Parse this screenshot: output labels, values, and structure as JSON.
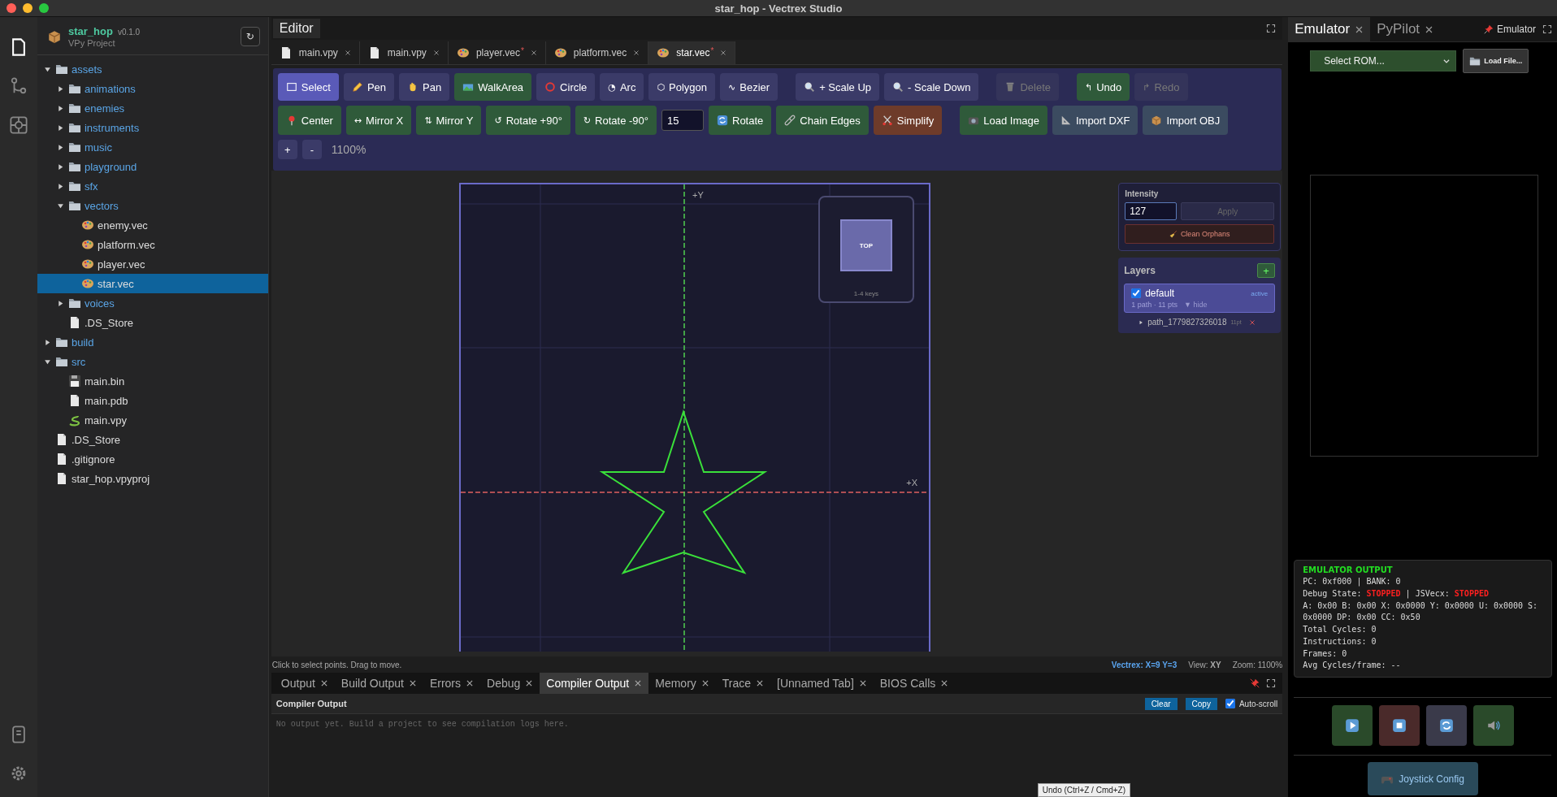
{
  "window": {
    "title": "star_hop - Vectrex Studio"
  },
  "sidebar": {
    "project": {
      "name": "star_hop",
      "version": "v0.1.0",
      "type": "VPy Project",
      "refresh": "↻"
    },
    "tree": [
      {
        "label": "assets",
        "kind": "folder",
        "expanded": true,
        "selected": false,
        "children": [
          {
            "label": "animations",
            "kind": "folder",
            "expanded": false,
            "selected": false
          },
          {
            "label": "enemies",
            "kind": "folder",
            "expanded": false,
            "selected": false
          },
          {
            "label": "instruments",
            "kind": "folder",
            "expanded": false,
            "selected": false
          },
          {
            "label": "music",
            "kind": "folder",
            "expanded": false,
            "selected": false
          },
          {
            "label": "playground",
            "kind": "folder",
            "expanded": false,
            "selected": false
          },
          {
            "label": "sfx",
            "kind": "folder",
            "expanded": false,
            "selected": false
          },
          {
            "label": "vectors",
            "kind": "folder",
            "expanded": true,
            "selected": false,
            "children": [
              {
                "label": "enemy.vec",
                "kind": "vector",
                "selected": false
              },
              {
                "label": "platform.vec",
                "kind": "vector",
                "selected": false
              },
              {
                "label": "player.vec",
                "kind": "vector",
                "selected": false
              },
              {
                "label": "star.vec",
                "kind": "vector",
                "selected": true
              }
            ]
          },
          {
            "label": "voices",
            "kind": "folder",
            "expanded": false,
            "selected": false
          },
          {
            "label": ".DS_Store",
            "kind": "file",
            "selected": false
          }
        ]
      },
      {
        "label": "build",
        "kind": "folder",
        "expanded": false,
        "selected": false
      },
      {
        "label": "src",
        "kind": "folder",
        "expanded": true,
        "selected": false,
        "children": [
          {
            "label": "main.bin",
            "kind": "binary",
            "selected": false
          },
          {
            "label": "main.pdb",
            "kind": "file",
            "selected": false
          },
          {
            "label": "main.vpy",
            "kind": "script",
            "selected": false
          }
        ]
      },
      {
        "label": ".DS_Store",
        "kind": "file",
        "selected": false
      },
      {
        "label": ".gitignore",
        "kind": "file",
        "selected": false
      },
      {
        "label": "star_hop.vpyproj",
        "kind": "file",
        "selected": false
      }
    ]
  },
  "editor": {
    "title": "Editor",
    "tabs": [
      {
        "label": "main.vpy",
        "kind": "file",
        "selected": false
      },
      {
        "label": "main.vpy",
        "kind": "file",
        "selected": false
      },
      {
        "label": "player.vec",
        "kind": "vector",
        "dirty_mark": "*",
        "selected": false
      },
      {
        "label": "platform.vec",
        "kind": "vector",
        "selected": false
      },
      {
        "label": "star.vec",
        "kind": "vector",
        "dirty_mark": "*",
        "selected": true
      }
    ],
    "toolbar": {
      "rows": [
        {
          "groups": [
            {
              "items": [
                {
                  "kind": "button",
                  "label": "Select",
                  "color": "#5a5ab8",
                  "disabled": false
                },
                {
                  "kind": "button",
                  "label": "Pen",
                  "color": "#3b3b68",
                  "disabled": false
                },
                {
                  "kind": "button",
                  "label": "Pan",
                  "color": "#3b3b68",
                  "disabled": false
                },
                {
                  "kind": "button",
                  "label": "WalkArea",
                  "color": "#2f5a3a",
                  "disabled": false
                },
                {
                  "kind": "button",
                  "label": "Circle",
                  "color": "#3b3b68",
                  "disabled": false
                },
                {
                  "kind": "button",
                  "glyph": "◔",
                  "label": "Arc",
                  "color": "#3b3b68",
                  "disabled": false
                },
                {
                  "kind": "button",
                  "glyph": "⬡",
                  "label": "Polygon",
                  "color": "#3b3b68",
                  "disabled": false
                },
                {
                  "kind": "button",
                  "glyph": "∿",
                  "label": "Bezier",
                  "color": "#3b3b68",
                  "disabled": false
                }
              ]
            },
            {
              "items": [
                {
                  "kind": "button",
                  "label": "+ Scale Up",
                  "color": "#3b3b68",
                  "disabled": false
                },
                {
                  "kind": "button",
                  "label": "- Scale Down",
                  "color": "#3b3b68",
                  "disabled": false
                }
              ]
            },
            {
              "items": [
                {
                  "kind": "button",
                  "label": "Delete",
                  "color": "#34345a",
                  "disabled": true
                }
              ]
            },
            {
              "items": [
                {
                  "kind": "button",
                  "glyph": "↰",
                  "label": "Undo",
                  "color": "#2f5a3a",
                  "disabled": false
                },
                {
                  "kind": "button",
                  "glyph": "↱",
                  "label": "Redo",
                  "color": "#34345a",
                  "disabled": true
                }
              ]
            }
          ]
        },
        {
          "groups": [
            {
              "items": [
                {
                  "kind": "button",
                  "label": "Center",
                  "color": "#2f5a3a",
                  "disabled": false
                },
                {
                  "kind": "button",
                  "glyph": "↔",
                  "label": "Mirror X",
                  "color": "#2f5a3a",
                  "disabled": false
                },
                {
                  "kind": "button",
                  "glyph": "⇅",
                  "label": "Mirror Y",
                  "color": "#2f5a3a",
                  "disabled": false
                },
                {
                  "kind": "button",
                  "glyph": "↺",
                  "label": "Rotate +90°",
                  "color": "#2f5a3a",
                  "disabled": false
                },
                {
                  "kind": "button",
                  "glyph": "↻",
                  "label": "Rotate -90°",
                  "color": "#2f5a3a",
                  "disabled": false
                },
                {
                  "kind": "input",
                  "value": "15"
                },
                {
                  "kind": "button",
                  "label": "Rotate",
                  "color": "#2f5a3a",
                  "disabled": false
                },
                {
                  "kind": "button",
                  "label": "Chain Edges",
                  "color": "#2f5a3a",
                  "disabled": false
                },
                {
                  "kind": "button",
                  "label": "Simplify",
                  "color": "#6e3b2a",
                  "disabled": false
                }
              ]
            },
            {
              "items": [
                {
                  "kind": "button",
                  "label": "Load Image",
                  "color": "#2f5a3a",
                  "disabled": false
                },
                {
                  "kind": "button",
                  "label": "Import DXF",
                  "color": "#3b4b60",
                  "disabled": false
                },
                {
                  "kind": "button",
                  "label": "Import OBJ",
                  "color": "#3b4b60",
                  "disabled": false
                }
              ]
            }
          ]
        },
        {
          "groups": [
            {
              "items": [
                {
                  "kind": "small",
                  "label": "+",
                  "color": "#3b3b68",
                  "disabled": false
                },
                {
                  "kind": "small",
                  "label": "-",
                  "color": "#3b3b68",
                  "disabled": false
                },
                {
                  "kind": "text",
                  "label": "1100%"
                }
              ]
            }
          ]
        }
      ]
    },
    "canvas": {
      "y_axis": "+Y",
      "x_axis": "+X",
      "view_cube": {
        "face": "TOP",
        "hint": "1-4 keys"
      }
    },
    "intensity": {
      "title": "Intensity",
      "value": "127",
      "apply": "Apply",
      "clean": "Clean Orphans"
    },
    "layers": {
      "title": "Layers",
      "add": "+",
      "items": [
        {
          "name": "default",
          "visible": true,
          "status": "active",
          "meta": "1 path · 11 pts",
          "toggle": "▼ hide",
          "selected": true,
          "paths": [
            {
              "name": "path_1779827326018",
              "points": "11pt"
            }
          ]
        }
      ]
    },
    "status": {
      "hint": "Click to select points. Drag to move.",
      "coords": "Vectrex: X=9 Y=3",
      "view": "View: **XY**",
      "zoom": "Zoom: 1100%"
    }
  },
  "bottom_panel": {
    "tabs": [
      {
        "label": "Output",
        "selected": false
      },
      {
        "label": "Build Output",
        "selected": false
      },
      {
        "label": "Errors",
        "selected": false
      },
      {
        "label": "Debug",
        "selected": false
      },
      {
        "label": "Compiler Output",
        "selected": true
      },
      {
        "label": "Memory",
        "selected": false
      },
      {
        "label": "Trace",
        "selected": false
      },
      {
        "label": "[Unnamed Tab]",
        "selected": false
      },
      {
        "label": "BIOS Calls",
        "selected": false
      }
    ],
    "title": "Compiler Output",
    "clear": "Clear",
    "copy": "Copy",
    "auto_scroll": {
      "label": "Auto-scroll",
      "checked": true
    },
    "placeholder": "No output yet. Build a project to see compilation logs here.",
    "tooltip": "Undo (Ctrl+Z / Cmd+Z)"
  },
  "emulator": {
    "tabs": [
      {
        "label": "Emulator",
        "selected": true
      },
      {
        "label": "PyPilot",
        "selected": false
      }
    ],
    "pin_label": "Emulator",
    "rom_select": {
      "value": "Select ROM..."
    },
    "load_file": "Load File...",
    "output": {
      "title": "EMULATOR OUTPUT",
      "lines": [
        [
          {
            "text": "PC: 0xf000 | BANK: 0",
            "alert": false
          }
        ],
        [
          {
            "text": "Debug State: ",
            "alert": false
          },
          {
            "text": "STOPPED",
            "alert": true
          },
          {
            "text": " | JSVecx: ",
            "alert": false
          },
          {
            "text": "STOPPED",
            "alert": true
          }
        ],
        [
          {
            "text": "A: 0x00 B: 0x00 X: 0x0000 Y: 0x0000 U: 0x0000 S: 0x0000 DP: 0x00 CC: 0x50",
            "alert": false
          }
        ],
        [
          {
            "text": "Total Cycles: 0",
            "alert": false
          }
        ],
        [
          {
            "text": "Instructions: 0",
            "alert": false
          }
        ],
        [
          {
            "text": "Frames: 0",
            "alert": false
          }
        ],
        [
          {
            "text": "Avg Cycles/frame: --",
            "alert": false
          }
        ]
      ]
    },
    "joystick": "Joystick Config"
  }
}
